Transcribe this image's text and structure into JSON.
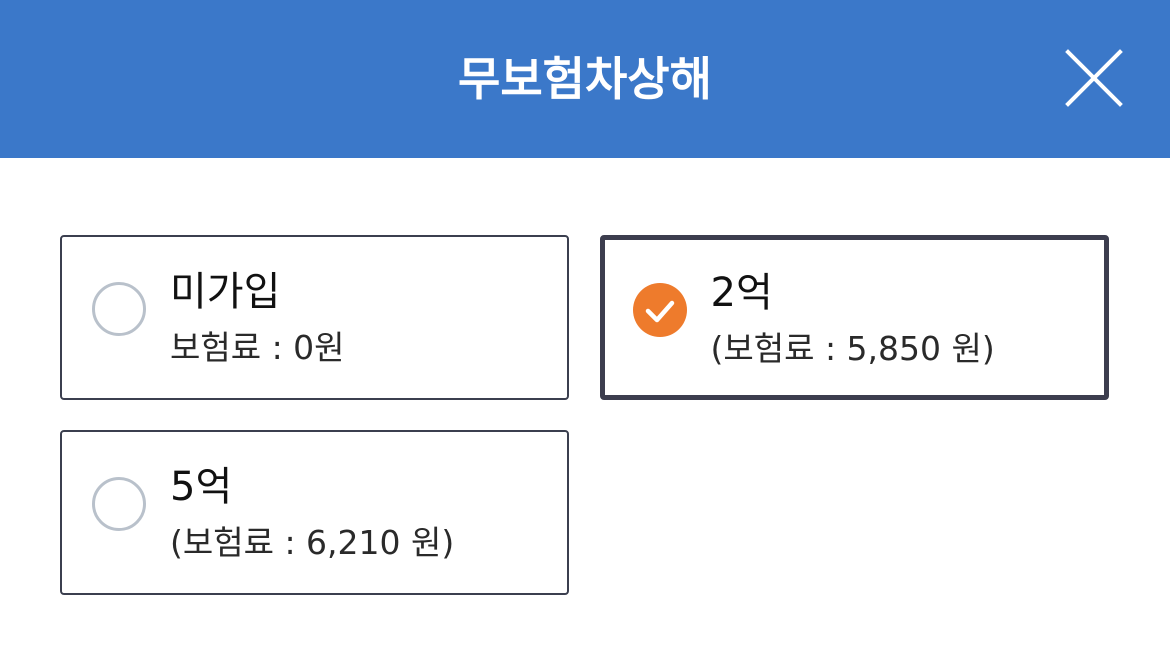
{
  "header": {
    "title": "무보험차상해",
    "close_icon": "close-icon"
  },
  "colors": {
    "header_bg": "#3b78c9",
    "selected_accent": "#ee7b2c",
    "border": "#3b3f4f",
    "radio_unselected": "#b9c1cb"
  },
  "options": [
    {
      "label": "미가입",
      "price": "보험료 : 0원",
      "selected": false
    },
    {
      "label": "2억",
      "price": "(보험료 : 5,850 원)",
      "selected": true
    },
    {
      "label": "5억",
      "price": "(보험료 : 6,210 원)",
      "selected": false
    }
  ]
}
